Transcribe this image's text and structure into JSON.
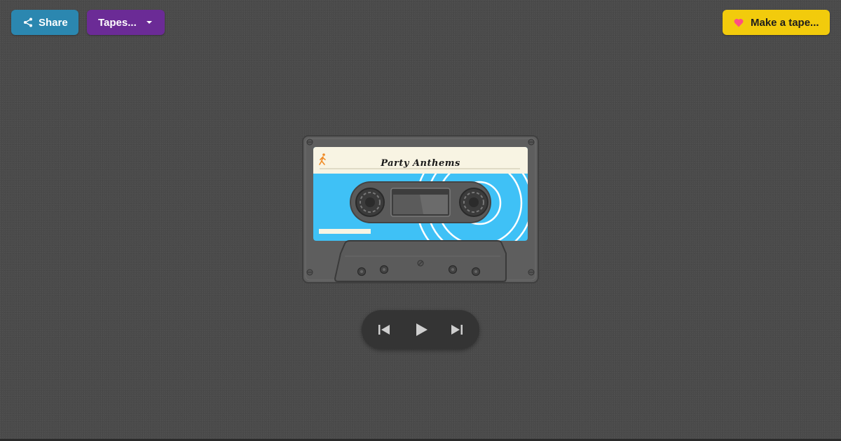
{
  "toolbar": {
    "share_label": "Share",
    "tapes_label": "Tapes...",
    "make_tape_label": "Make a tape..."
  },
  "cassette": {
    "title": "Party Anthems",
    "label_color": "#f8f4e3",
    "body_color": "#3fc1f6",
    "shell_color": "#5e5e5e",
    "label_icon": "walking-person-icon"
  },
  "player": {
    "controls": [
      "previous-icon",
      "play-icon",
      "next-icon"
    ]
  },
  "colors": {
    "share": "#2b87b0",
    "tapes": "#6b2b96",
    "make_tape": "#f2cb0c",
    "heart": "#ff4f82",
    "background": "#4a4a4a"
  }
}
